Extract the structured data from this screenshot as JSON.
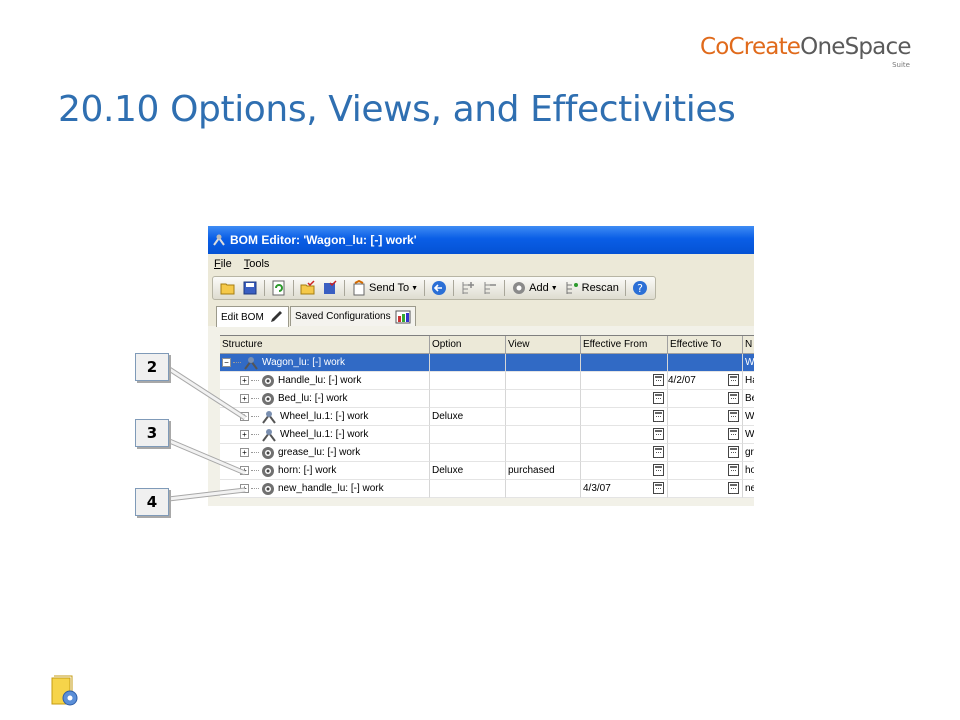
{
  "logo": {
    "part1": "CoCreate",
    "part2": "OneSpace",
    "suite": "Suite"
  },
  "slide_title": "20.10 Options, Views, and Effectivities",
  "window": {
    "title": "BOM Editor: 'Wagon_lu: [-] work'"
  },
  "menu": [
    {
      "accel": "F",
      "rest": "ile"
    },
    {
      "accel": "T",
      "rest": "ools"
    }
  ],
  "toolbar": {
    "send_to": "Send To",
    "add": "Add",
    "rescan": "Rescan",
    "help_icon": "help-icon"
  },
  "tabs": {
    "edit": "Edit BOM",
    "saved": "Saved Configurations"
  },
  "table": {
    "headers": [
      "Structure",
      "Option",
      "View",
      "Effective From",
      "Effective To",
      "N"
    ],
    "rows": [
      {
        "structure": "Wagon_lu: [-] work",
        "option": "",
        "view": "",
        "from": "",
        "to": "",
        "n": "W",
        "icon": "assembly-icon",
        "selected": true
      },
      {
        "structure": "Handle_lu: [-] work",
        "option": "",
        "view": "",
        "from": "",
        "to": "4/2/07",
        "n": "Ha",
        "icon": "part-icon"
      },
      {
        "structure": "Bed_lu: [-] work",
        "option": "",
        "view": "",
        "from": "",
        "to": "",
        "n": "Be",
        "icon": "part-icon"
      },
      {
        "structure": "Wheel_lu.1: [-] work",
        "option": "Deluxe",
        "view": "",
        "from": "",
        "to": "",
        "n": "W",
        "icon": "assembly-icon"
      },
      {
        "structure": "Wheel_lu.1: [-] work",
        "option": "",
        "view": "",
        "from": "",
        "to": "",
        "n": "W",
        "icon": "assembly-icon"
      },
      {
        "structure": "grease_lu: [-] work",
        "option": "",
        "view": "",
        "from": "",
        "to": "",
        "n": "gr",
        "icon": "part-icon"
      },
      {
        "structure": "horn: [-] work",
        "option": "Deluxe",
        "view": "purchased",
        "from": "",
        "to": "",
        "n": "ho",
        "icon": "part-icon"
      },
      {
        "structure": "new_handle_lu: [-] work",
        "option": "",
        "view": "",
        "from": "4/3/07",
        "to": "",
        "n": "ne",
        "icon": "part-icon"
      }
    ]
  },
  "callouts": [
    "2",
    "3",
    "4"
  ],
  "colors": {
    "title": "#2f6fb1",
    "brand_orange": "#e06a1b",
    "selection": "#316ac5",
    "titlebar": "#0a5ee6"
  }
}
